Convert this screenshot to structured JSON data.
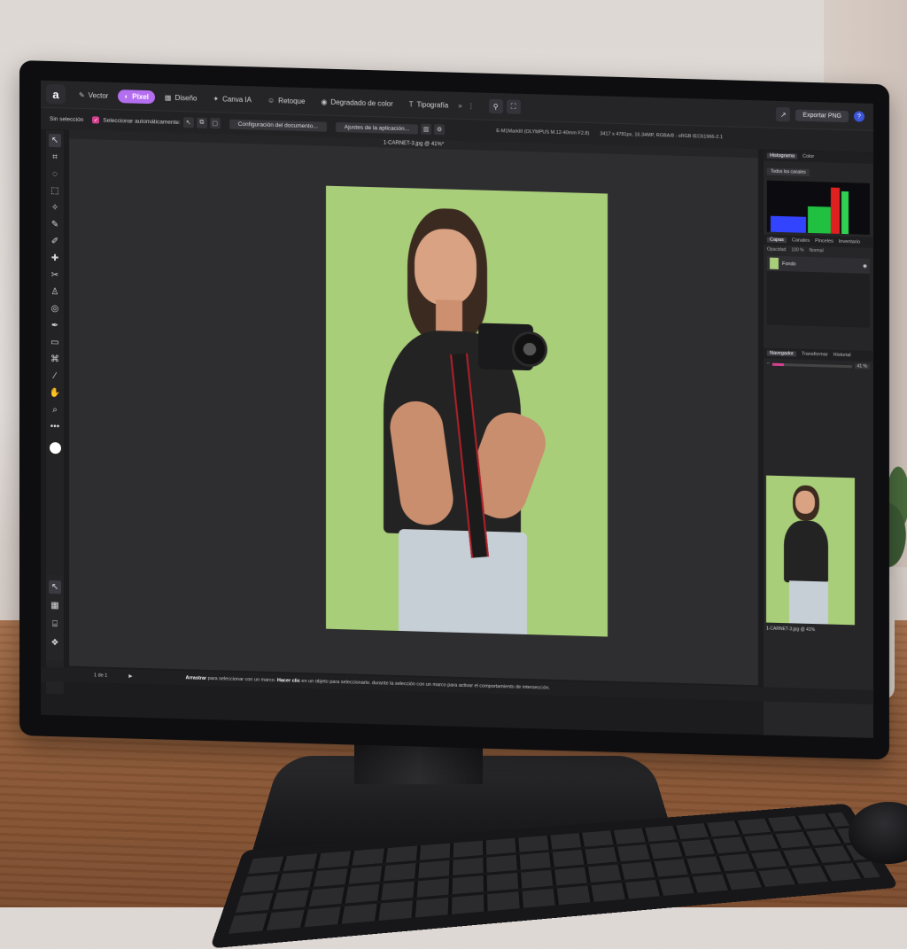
{
  "app": {
    "logo_letter": "a",
    "personas": [
      {
        "label": "Vector",
        "icon": "vector-persona-icon"
      },
      {
        "label": "Píxel",
        "icon": "pixel-persona-icon",
        "active": true
      },
      {
        "label": "Diseño",
        "icon": "layout-persona-icon"
      },
      {
        "label": "Canva IA",
        "icon": "sparkle-icon"
      },
      {
        "label": "Retoque",
        "icon": "person-icon"
      },
      {
        "label": "Degradado de color",
        "icon": "camera-icon"
      },
      {
        "label": "Tipografía",
        "icon": "type-icon"
      }
    ],
    "more_symbol": "»",
    "export_label": "Exportar PNG",
    "help_symbol": "?",
    "accent_color": "#b46ef0",
    "checkbox_color": "#d6408f"
  },
  "context": {
    "selection_label": "Sin selección",
    "auto_select_label": "Seleccionar automáticamente:",
    "doc_setup_label": "Configuración del documento...",
    "app_settings_label": "Ajustes de la aplicación...",
    "camera_info": "E-M1MarkIII (OLYMPUS M.12-40mm F2.8)",
    "image_info": "3417 x 4781px, 16.34MP, RGBA/8 - sRGB IEC61966-2.1"
  },
  "document": {
    "title": "1-CARNET-3.jpg @ 41%*"
  },
  "panels": {
    "histogram_tab": "Histograma",
    "color_tab": "Color",
    "channels_select": "Todos los canales",
    "layer_tabs": [
      "Capas",
      "Canales",
      "Pinceles",
      "Inventario"
    ],
    "opacity_label": "Opacidad",
    "opacity_value": "100 %",
    "blend_mode": "Normal",
    "layer_name": "Fondo",
    "nav_tabs": [
      "Navegador",
      "Transformar",
      "Historial"
    ],
    "zoom_value": "41 %",
    "nav_file": "1-CARNET-3.jpg @ 41%"
  },
  "status": {
    "page": "1 de 1",
    "hint_bold_1": "Arrastrar",
    "hint_1": "para seleccionar con un marco.",
    "hint_bold_2": "Hacer clic",
    "hint_2": "en un objeto para seleccionarlo.",
    "hint_3": "durante la selección con un marco para activar el comportamiento de intersección."
  }
}
